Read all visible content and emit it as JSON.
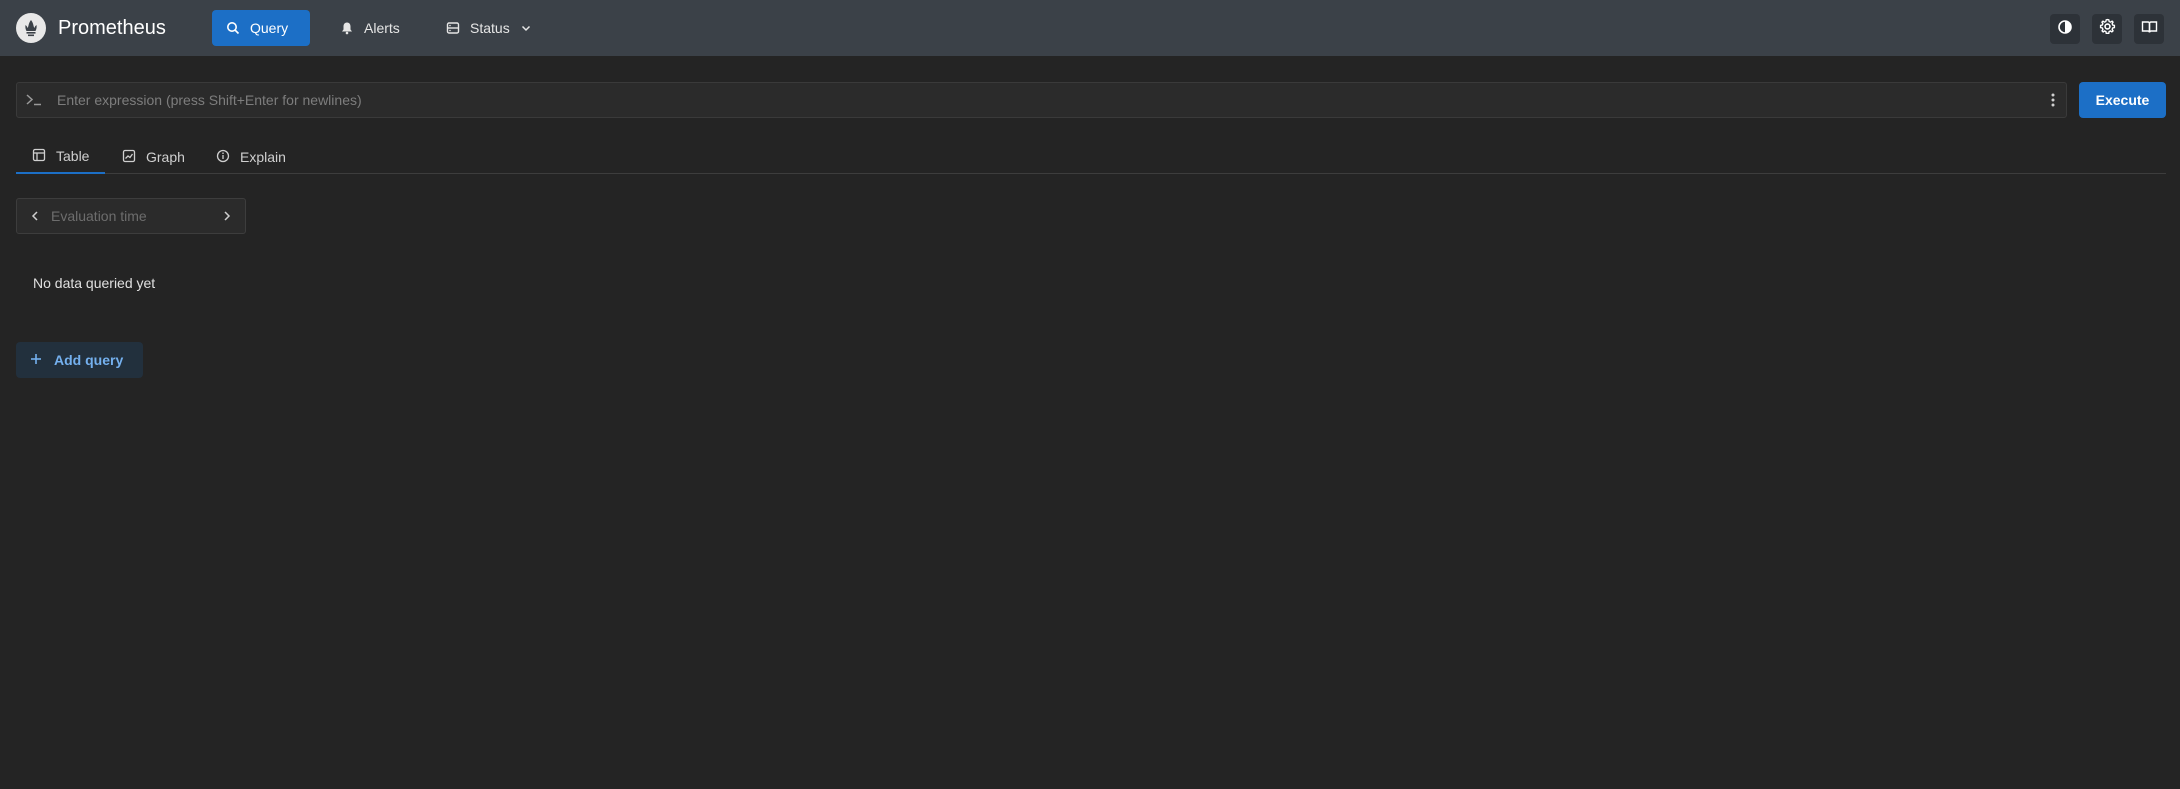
{
  "app": {
    "title": "Prometheus"
  },
  "nav": {
    "query": "Query",
    "alerts": "Alerts",
    "status": "Status"
  },
  "expression": {
    "placeholder": "Enter expression (press Shift+Enter for newlines)",
    "value": ""
  },
  "execute_label": "Execute",
  "tabs": [
    {
      "label": "Table",
      "active": true
    },
    {
      "label": "Graph",
      "active": false
    },
    {
      "label": "Explain",
      "active": false
    }
  ],
  "evaluation": {
    "placeholder": "Evaluation time"
  },
  "status_text": "No data queried yet",
  "add_query_label": "Add query",
  "colors": {
    "header": "#3b4148",
    "background": "#242424",
    "accent": "#1c6fc6",
    "add_query_text": "#74b0ee"
  },
  "icons": {
    "logo": "prometheus-logo",
    "query": "search-icon",
    "alerts": "bell-icon",
    "status": "server-icon",
    "theme": "contrast-icon",
    "settings": "gear-icon",
    "docs": "book-icon"
  }
}
